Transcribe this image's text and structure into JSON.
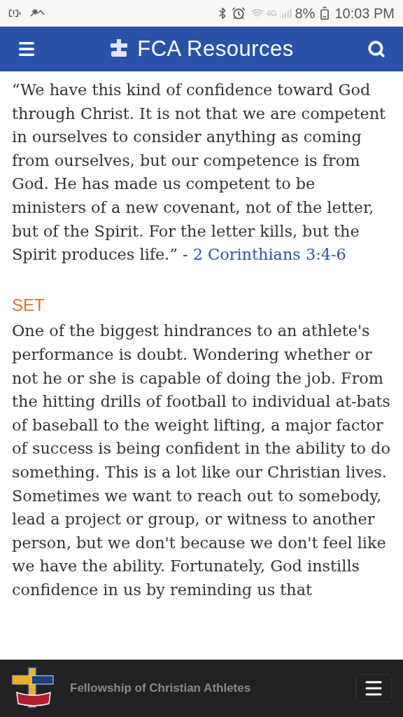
{
  "status_bar": {
    "network": "4G",
    "battery": "8%",
    "time": "10:03 PM"
  },
  "header": {
    "title": "FCA Resources"
  },
  "content": {
    "quote": "“We have this kind of confidence toward God through Christ. It is not that we are competent in ourselves to consider anything as coming from ourselves, but our competence is from God. He has made us competent to be ministers of a new covenant, not of the letter, but of the Spirit. For the letter kills, but the Spirit produces life.” - ",
    "reference": "2 Corinthians 3:4-6",
    "heading": "SET",
    "paragraph": "One of the biggest hindrances to an athlete's performance is doubt. Wondering whether or not he or she is capable of doing the job. From the hitting drills of football to individual at-bats of baseball to the weight lifting, a major factor of success is being confident in the ability to do something. This is a lot like our Christian lives. Sometimes we want to reach out to somebody, lead a project or group, or witness to another person, but we don't because we don't feel like we have the ability. Fortunately, God instills confidence in us by reminding us that"
  },
  "footer": {
    "title": "Fellowship of Christian Athletes"
  }
}
